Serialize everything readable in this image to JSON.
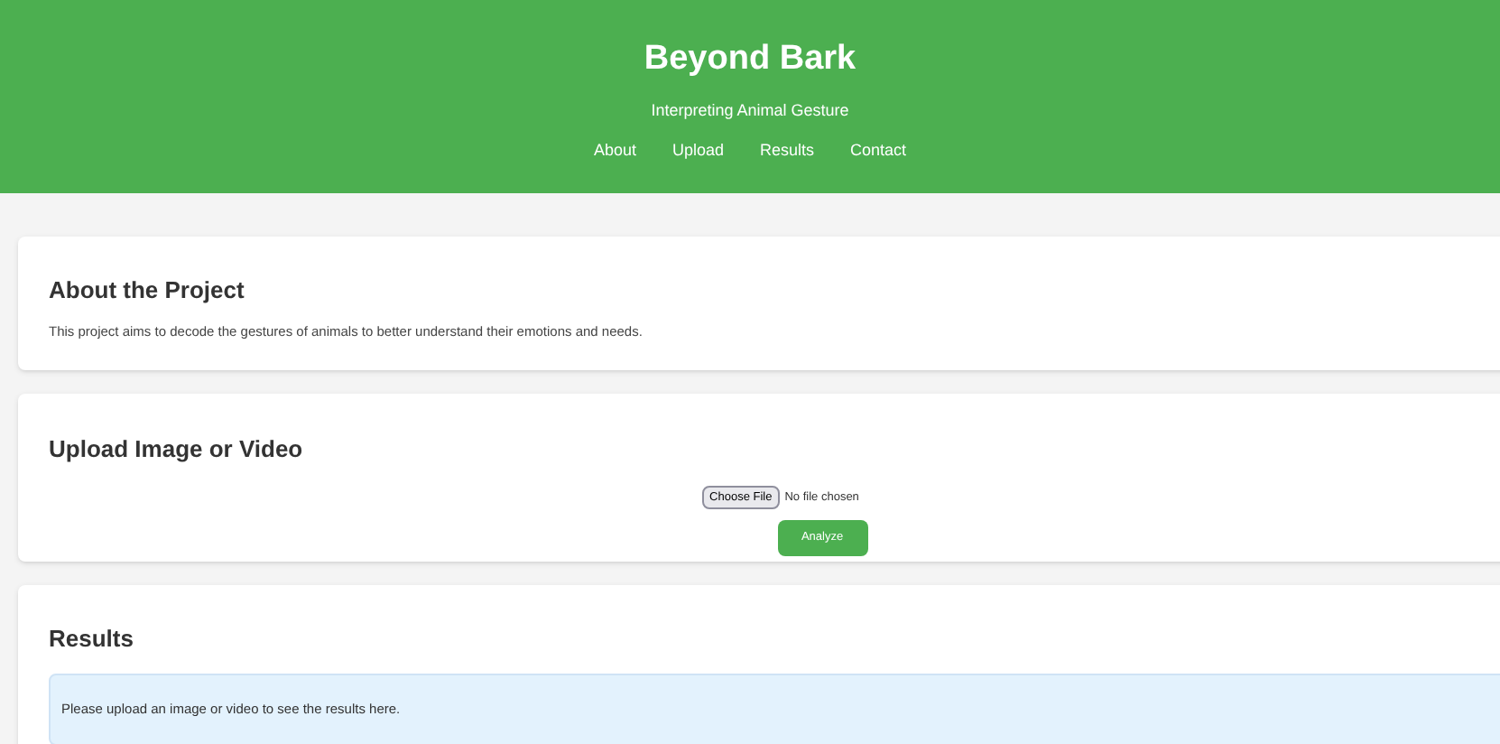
{
  "header": {
    "title": "Beyond Bark",
    "subtitle": "Interpreting Animal Gesture",
    "nav": [
      "About",
      "Upload",
      "Results",
      "Contact"
    ]
  },
  "about": {
    "heading": "About the Project",
    "text": "This project aims to decode the gestures of animals to better understand their emotions and needs."
  },
  "upload": {
    "heading": "Upload Image or Video",
    "file_button": "Choose File",
    "file_status": "No file chosen",
    "submit": "Analyze"
  },
  "results": {
    "heading": "Results",
    "message": "Please upload an image or video to see the results here."
  }
}
